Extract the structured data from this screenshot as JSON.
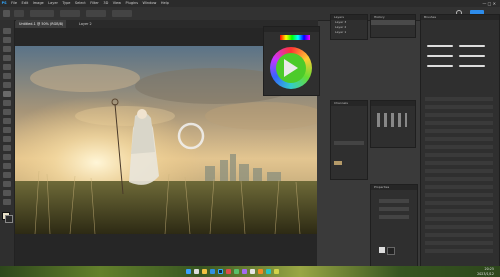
{
  "menubar": {
    "items": [
      "PS",
      "File",
      "Edit",
      "Image",
      "Layer",
      "Type",
      "Select",
      "Filter",
      "3D",
      "View",
      "Plugins",
      "Window",
      "Help"
    ]
  },
  "tabs": [
    {
      "label": "Untitled-1 @ 50% (RGB/8)",
      "active": true
    },
    {
      "label": "Layer 2",
      "active": false
    }
  ],
  "colors": {
    "accent": "#2d8ceb",
    "wheel_center": "#4ccb2a"
  },
  "layers_panel": {
    "title": "Layers",
    "rows": [
      "Layer 3",
      "Layer 2",
      "Layer 1",
      "Background"
    ]
  },
  "history_panel": {
    "title": "History"
  },
  "brushes_panel": {
    "title": "Brushes"
  },
  "properties_panel": {
    "title": "Properties"
  },
  "channels_panel": {
    "title": "Channels"
  },
  "taskbar": {
    "time": "20:25",
    "date": "2023/1/12"
  }
}
